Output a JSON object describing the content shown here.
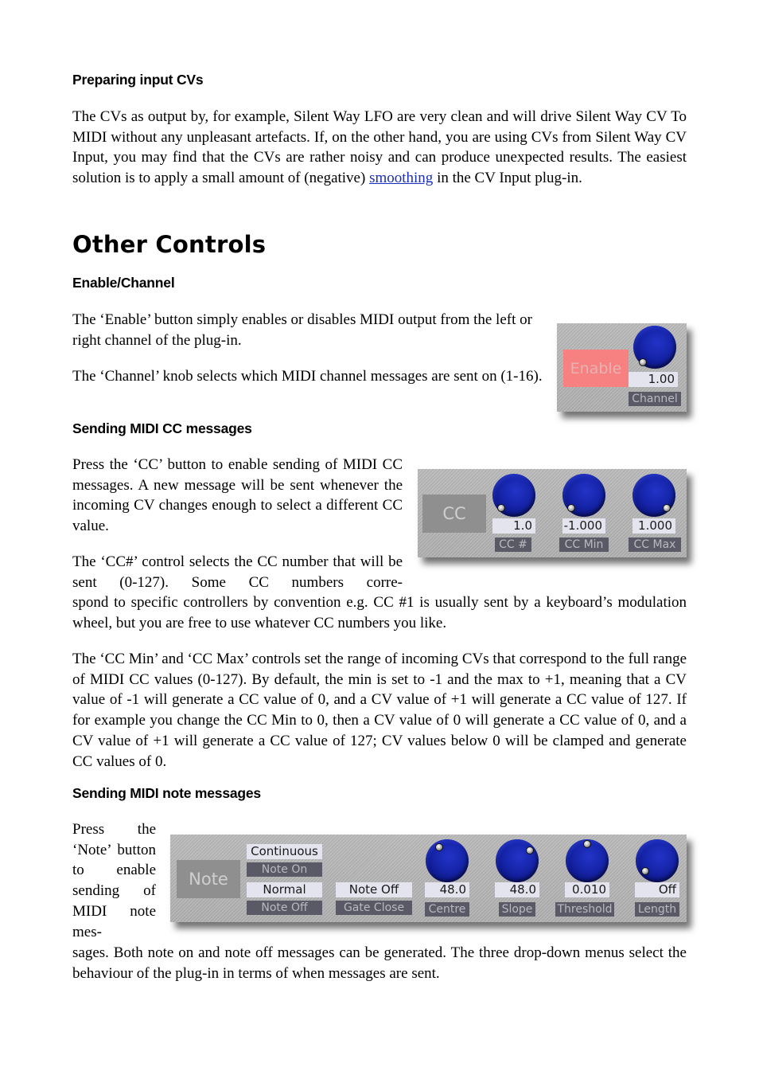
{
  "sections": {
    "preparing": {
      "heading": "Preparing input CVs",
      "para_before_link": "The CVs as output by, for example, Silent Way LFO are very clean and will drive Silent Way CV To MIDI without any unpleasant artefacts. If, on the other hand, you are using CVs from Silent Way CV Input, you may find that the CVs are rather noisy and can pro­duce unexpected results. The easiest solution is to apply a small amount of (negative) ",
      "link": "smoothing",
      "para_after_link": " in the CV Input plug-in."
    },
    "other_controls": {
      "title": "Other Controls"
    },
    "enable_channel": {
      "heading": "Enable/Channel",
      "para1": "The ‘Enable’ button simply enables or disables MIDI output from the left or right channel of the plug-in.",
      "para2": "The ‘Channel’ knob selects which MIDI channel messages are sent on (1-16)."
    },
    "cc": {
      "heading": "Sending MIDI CC messages",
      "para1": "Press the ‘CC’ button to enable sending of MIDI CC messages. A new message will be sent whenever the incoming CV changes enough to select a different CC value.",
      "para2a": "The ‘CC#’ control selects the CC number that will be sent (0-127). Some CC numbers corre-",
      "para2b": "spond to specific controllers by convention e.g. CC #1 is usually sent by a keyboard’s modulation wheel, but you are free to use whatever CC numbers you like.",
      "para3": "The ‘CC Min’ and ‘CC Max’ controls set the range of incoming CVs that correspond to the full range of MIDI CC values (0-127). By default, the min is set to -1 and the max to +1, meaning that a CV value of -1 will generate a CC value of 0, and a CV value of +1 will generate a CC value of 127. If for example you change the CC Min to 0, then a CV value of 0 will generate a CC value of 0, and a CV value of +1 will generate a CC value of 127; CV values below 0 will be clamped and generate CC values of 0."
    },
    "note": {
      "heading": "Sending MIDI note messages",
      "para_narrow": "Press the ‘Note’ but­ton to en­able send­ing of MIDI note mes-",
      "para_wide": "sages. Both note on and note off messages can be generated. The three drop-down menus select the behaviour of the plug-in in terms of when messages are sent."
    }
  },
  "panels": {
    "enable_panel": {
      "enable_button": "Enable",
      "enable_color": "#f78080",
      "channel_value": "1.00",
      "channel_label": "Channel"
    },
    "cc_panel": {
      "cc_button": "CC",
      "knobs": [
        {
          "label": "CC #",
          "value": "1.0"
        },
        {
          "label": "CC Min",
          "value": "-1.000"
        },
        {
          "label": "CC Max",
          "value": "1.000"
        }
      ]
    },
    "note_panel": {
      "note_button": "Note",
      "menus": [
        {
          "selected": "Continuous",
          "label": "Note On"
        },
        {
          "selected": "Normal",
          "label": "Note Off"
        },
        {
          "selected": "Note Off",
          "label": "Gate Close"
        }
      ],
      "knobs": [
        {
          "label": "Centre",
          "value": "48.0"
        },
        {
          "label": "Slope",
          "value": "48.0"
        },
        {
          "label": "Threshold",
          "value": "0.010"
        },
        {
          "label": "Length",
          "value": "Off"
        }
      ]
    }
  },
  "colors": {
    "link": "#1a2fb5",
    "knob": "#1524a8",
    "panel": "#adadad"
  }
}
